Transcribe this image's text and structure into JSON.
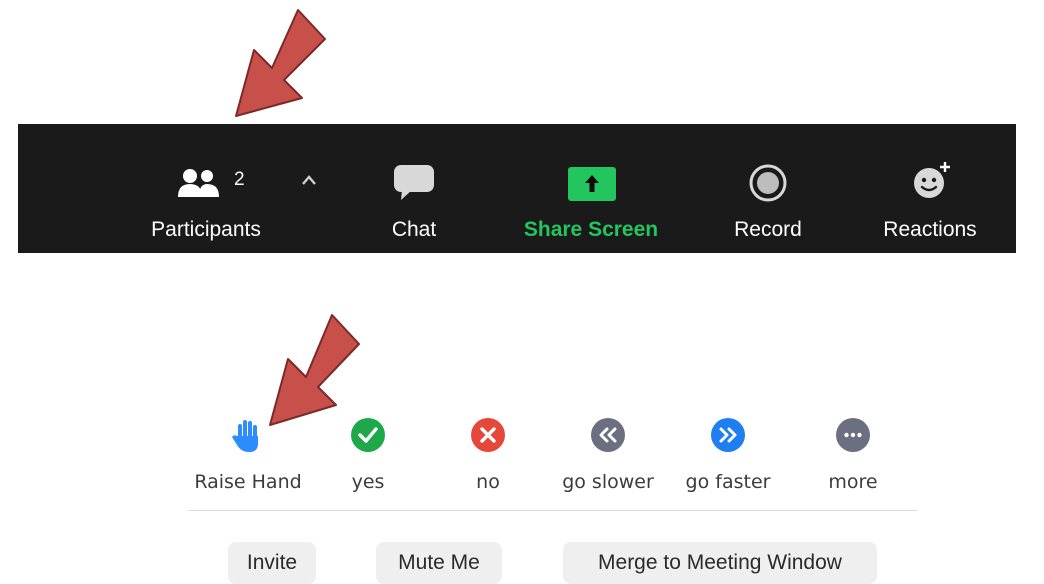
{
  "toolbar": {
    "participants_label": "Participants",
    "participants_count": "2",
    "chat_label": "Chat",
    "share_label": "Share Screen",
    "record_label": "Record",
    "reactions_label": "Reactions"
  },
  "reactions": {
    "raise_hand": "Raise Hand",
    "yes": "yes",
    "no": "no",
    "slower": "go slower",
    "faster": "go faster",
    "more": "more"
  },
  "actions": {
    "invite": "Invite",
    "mute": "Mute Me",
    "merge": "Merge to Meeting Window"
  },
  "colors": {
    "toolbar_bg": "#1a1a1a",
    "share_green": "#22c55e",
    "arrow_red": "#c8504b",
    "raise_hand_blue": "#2d8cff",
    "yes_green": "#1ea84a",
    "no_red": "#e5483b",
    "slower_gray": "#6b6f7f",
    "faster_blue": "#1f7ff0",
    "more_gray": "#6b6f7f"
  },
  "icons": [
    "participants-icon",
    "chevron-up-icon",
    "chat-icon",
    "share-screen-icon",
    "record-icon",
    "reactions-icon",
    "raise-hand-icon",
    "check-icon",
    "close-icon",
    "rewind-icon",
    "fast-forward-icon",
    "more-icon",
    "arrow-annotation-icon"
  ]
}
